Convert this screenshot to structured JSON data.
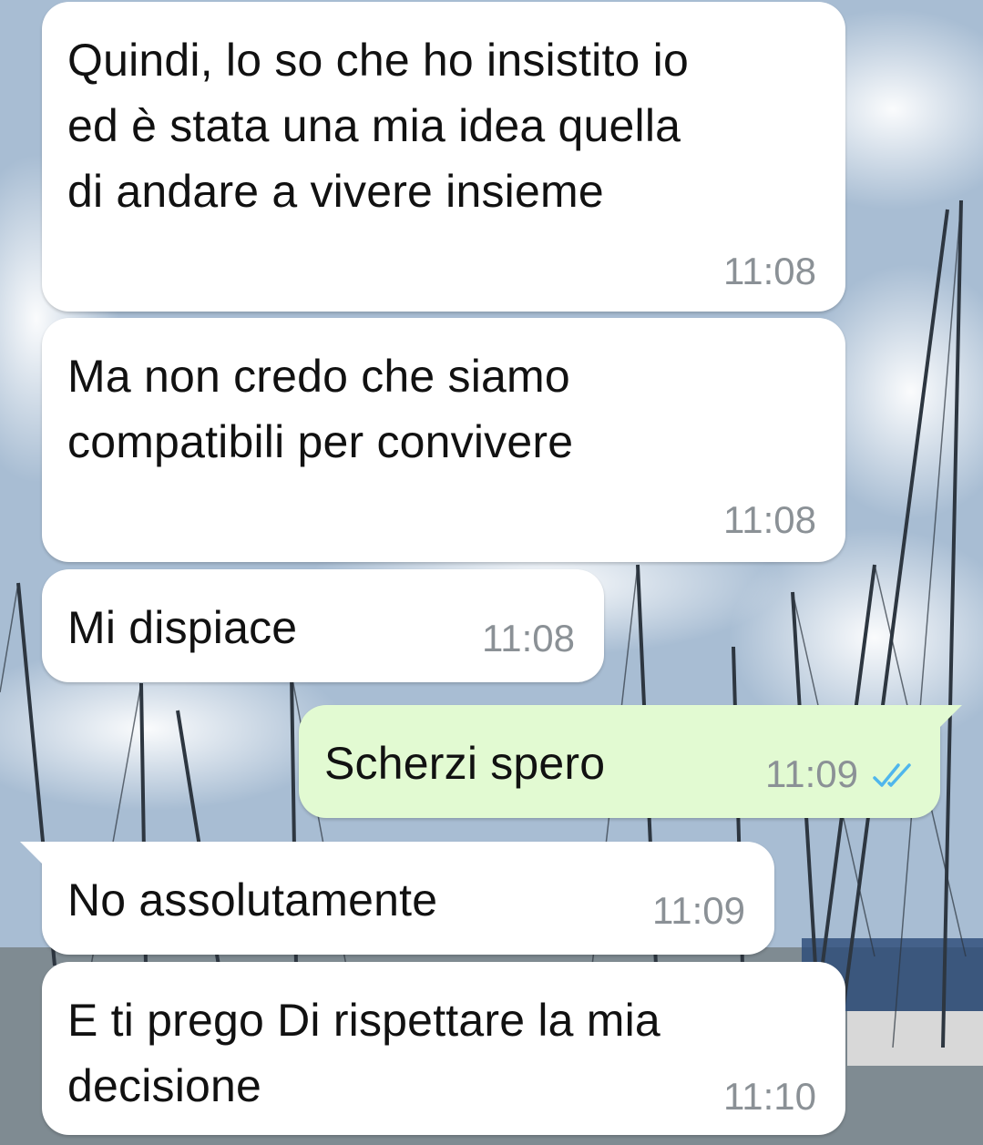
{
  "conversation": {
    "messages": [
      {
        "direction": "incoming",
        "text": "Quindi, lo so che ho insistito io\ned è stata una mia idea quella\ndi andare a vivere insieme",
        "time": "11:08"
      },
      {
        "direction": "incoming",
        "text": "Ma non credo che siamo\ncompatibili per convivere",
        "time": "11:08"
      },
      {
        "direction": "incoming",
        "text": "Mi dispiace",
        "time": "11:08"
      },
      {
        "direction": "outgoing",
        "text": "Scherzi spero",
        "time": "11:09",
        "status_icon": "double-check-read-icon"
      },
      {
        "direction": "incoming",
        "text": "No assolutamente",
        "time": "11:09"
      },
      {
        "direction": "incoming",
        "text": "E ti prego Di rispettare la mia\ndecisione",
        "time": "11:10"
      }
    ]
  },
  "colors": {
    "incoming_bubble": "#ffffff",
    "outgoing_bubble": "#e2fad2",
    "timestamp": "#8b9196",
    "read_ticks": "#4fb6ec"
  }
}
